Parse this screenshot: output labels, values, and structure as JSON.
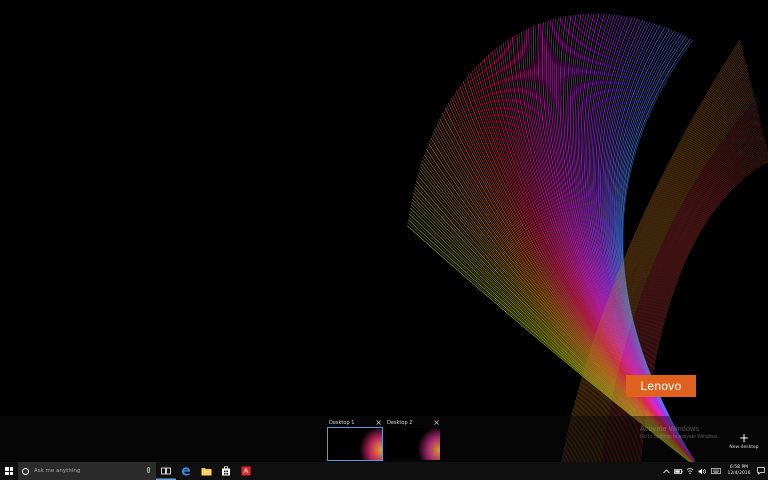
{
  "wallpaper": {
    "brand_logo_text": "Lenovo",
    "brand_color": "#e1621f"
  },
  "watermark": {
    "title": "Activate Windows",
    "subtitle": "Go to Settings to activate Windows."
  },
  "task_view": {
    "desktops": [
      {
        "label": "Desktop 1",
        "active": true
      },
      {
        "label": "Desktop 2",
        "active": false
      }
    ],
    "new_desktop_label": "New desktop",
    "accent": "#5b9bd5"
  },
  "taskbar": {
    "search_placeholder": "Ask me anything",
    "pinned": [
      "task-view-icon",
      "edge-icon",
      "file-explorer-icon",
      "store-icon",
      "red-app-icon"
    ],
    "tray": [
      "chevron-up-icon",
      "battery-icon",
      "network-icon",
      "volume-icon",
      "keyboard-icon"
    ],
    "clock": {
      "time": "6:58 PM",
      "date": "12/4/2016"
    }
  }
}
